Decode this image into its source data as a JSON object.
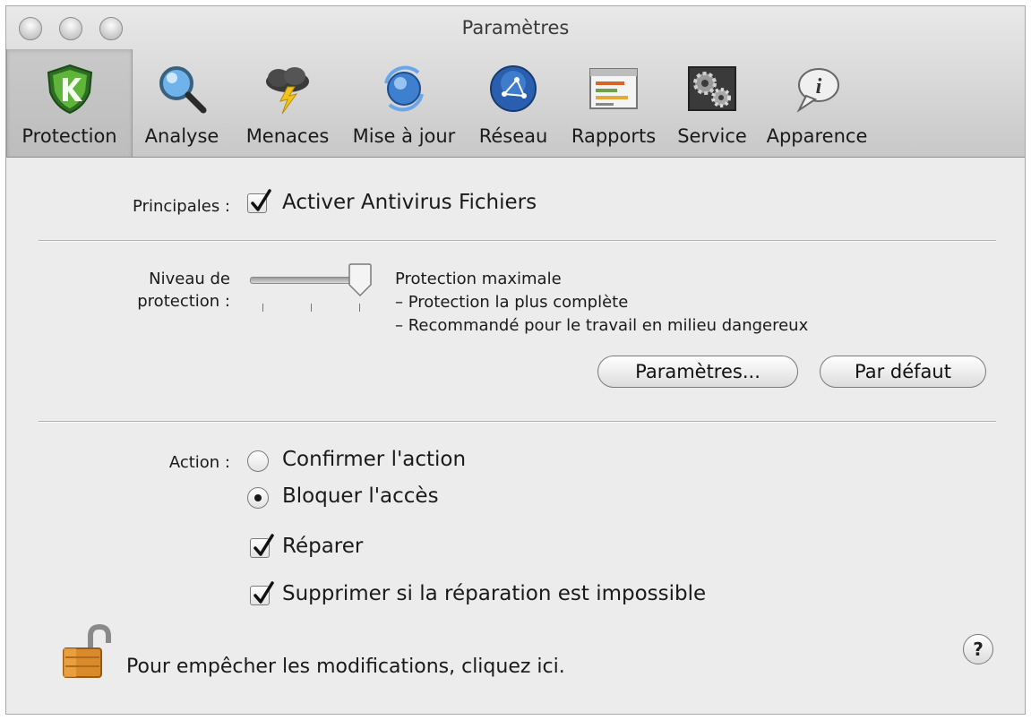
{
  "window": {
    "title": "Paramètres"
  },
  "toolbar": {
    "items": [
      {
        "label": "Protection",
        "icon": "shield-k-icon",
        "selected": true
      },
      {
        "label": "Analyse",
        "icon": "magnifier-icon"
      },
      {
        "label": "Menaces",
        "icon": "storm-cloud-icon"
      },
      {
        "label": "Mise à jour",
        "icon": "update-globe-icon"
      },
      {
        "label": "Réseau",
        "icon": "network-icon"
      },
      {
        "label": "Rapports",
        "icon": "reports-icon"
      },
      {
        "label": "Service",
        "icon": "gears-icon"
      },
      {
        "label": "Apparence",
        "icon": "speech-bubble-info-icon"
      }
    ]
  },
  "main": {
    "principal_label": "Principales :",
    "antivirus_label": "Activer Antivirus Fichiers",
    "antivirus_checked": true,
    "level_label_line1": "Niveau de",
    "level_label_line2": "protection :",
    "level_value": 3,
    "level_max": 3,
    "level_desc_title": "Protection maximale",
    "level_desc_line1": "– Protection la plus complète",
    "level_desc_line2": "– Recommandé pour le travail en milieu dangereux",
    "settings_button": "Paramètres...",
    "default_button": "Par défaut",
    "action_label": "Action :",
    "actions": [
      {
        "label": "Confirmer l'action",
        "selected": false
      },
      {
        "label": "Bloquer l'accès",
        "selected": true
      }
    ],
    "repair_label": "Réparer",
    "repair_checked": true,
    "delete_label": "Supprimer si la réparation est impossible",
    "delete_checked": true,
    "lock_text": "Pour empêcher les modifications, cliquez ici.",
    "help_label": "?"
  }
}
